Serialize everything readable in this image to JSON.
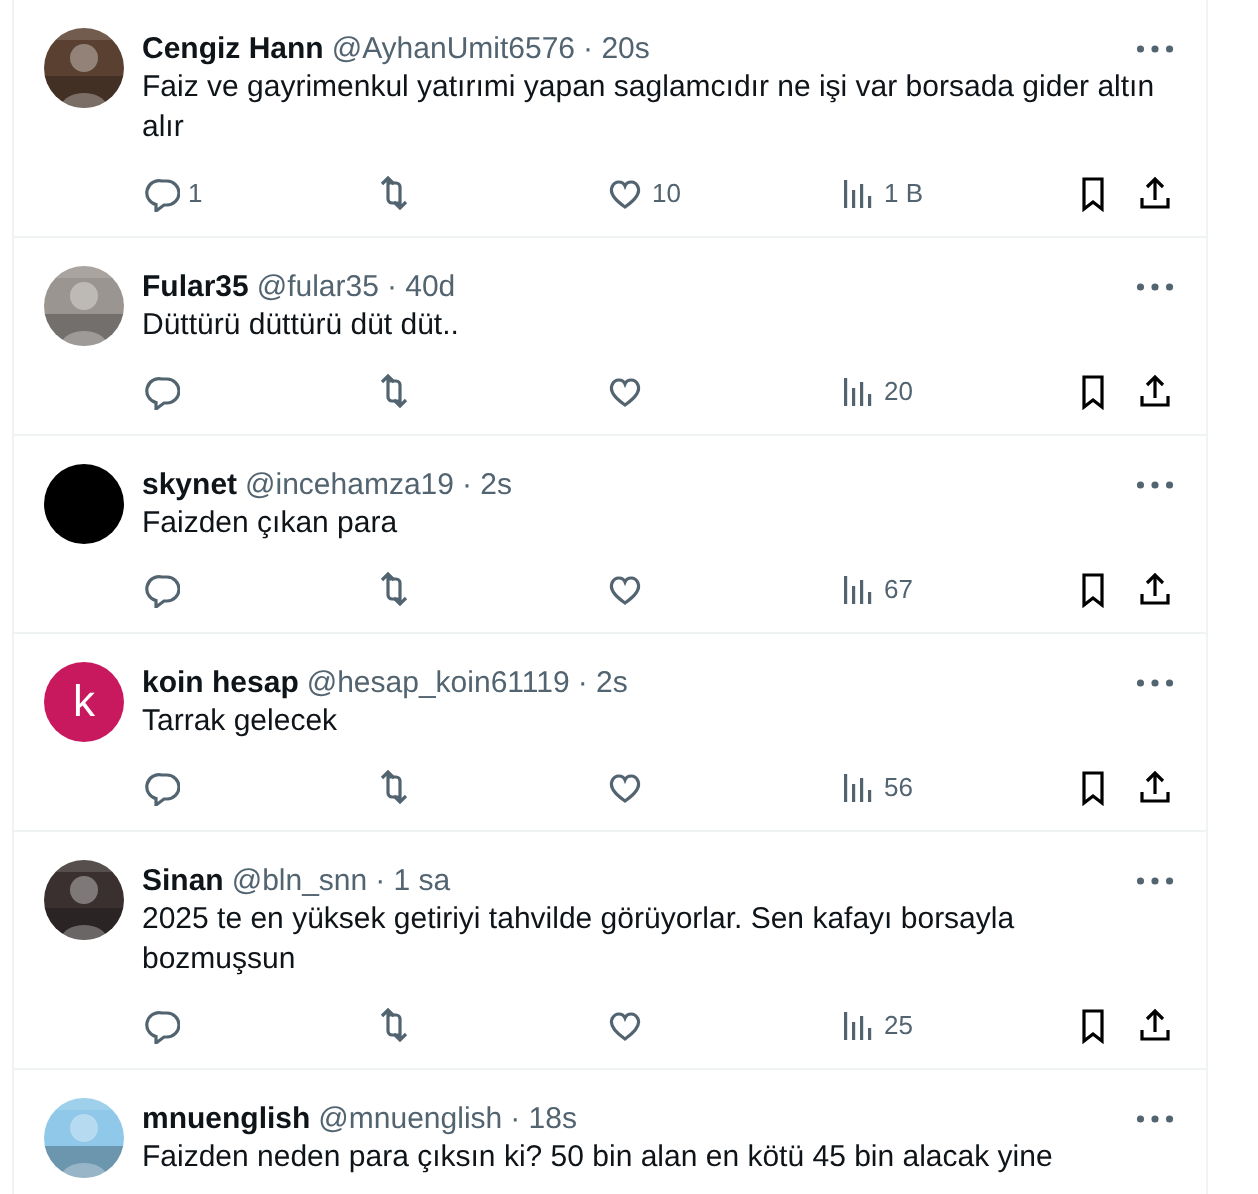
{
  "tweets": [
    {
      "name": "Cengiz Hann",
      "handle": "@AyhanUmit6576",
      "time": "· 20s",
      "avatar": {
        "kind": "picture"
      },
      "text_lines": [
        "Faiz ve gayrimenkul yatırımi yapan saglamcıdır ne işi var borsada gider altın",
        "alır"
      ],
      "replies": "1",
      "likes": "10",
      "views": "1 B"
    },
    {
      "name": "Fular35",
      "handle": "@fular35",
      "time": "· 40d",
      "avatar": {
        "kind": "picture"
      },
      "text_lines": [
        "Düttürü düttürü düt düt.."
      ],
      "views": "20"
    },
    {
      "name": "skynet",
      "handle": "@incehamza19",
      "time": "· 2s",
      "avatar": {
        "kind": "plain",
        "color": "#000000"
      },
      "text_lines": [
        "Faizden çıkan para"
      ],
      "views": "67"
    },
    {
      "name": "koin hesap",
      "handle": "@hesap_koin61119",
      "time": "· 2s",
      "avatar": {
        "kind": "letter",
        "color": "#c8195f",
        "letter": "k"
      },
      "text_lines": [
        "Tarrak gelecek"
      ],
      "views": "56"
    },
    {
      "name": "Sinan",
      "handle": "@bln_snn",
      "time": "· 1 sa",
      "avatar": {
        "kind": "picture"
      },
      "text_lines": [
        "2025 te en yüksek getiriyi tahvilde görüyorlar. Sen kafayı borsayla",
        "bozmuşsun"
      ],
      "views": "25"
    },
    {
      "name": "mnuenglish",
      "handle": "@mnuenglish",
      "time": "· 18s",
      "avatar": {
        "kind": "picture"
      },
      "text_lines": [
        "Faizden neden para çıksın ki? 50 bin alan en kötü 45 bin alacak yine"
      ]
    }
  ]
}
